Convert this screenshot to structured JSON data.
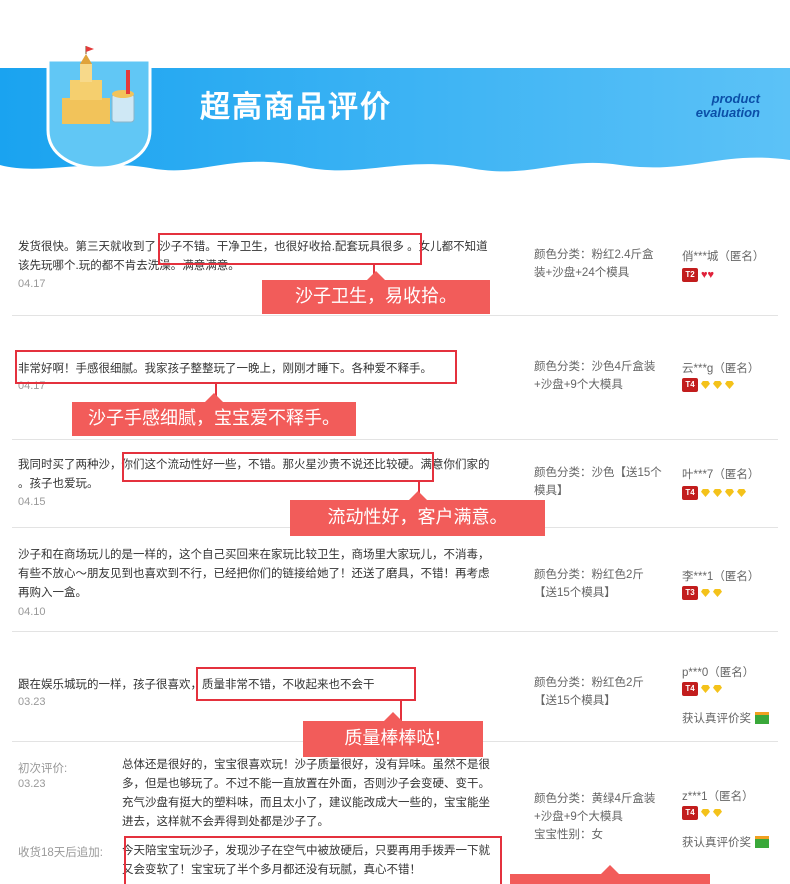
{
  "banner": {
    "title": "超高商品评价",
    "en_line1": "product",
    "en_line2": "evaluation"
  },
  "callouts": [
    "沙子卫生，易收拾。",
    "沙子手感细腻，宝宝爱不释手。",
    "流动性好，客户满意。",
    "质量棒棒哒!"
  ],
  "reviews": [
    {
      "lines": [
        "发货很快。第三天就收到了 沙子不错。干净卫生，也很好收拾.配套玩具很多 。女儿都不知道",
        "该先玩哪个.玩的都不肯去洗澡。满意满意。"
      ],
      "date": "04.17",
      "sku": [
        "颜色分类：粉红2.4斤盒",
        "装+沙盘+24个模具"
      ],
      "user": "俏***城（匿名）",
      "tier": "T2"
    },
    {
      "lines": [
        "非常好啊！手感很细腻。我家孩子整整玩了一晚上，刚刚才睡下。各种爱不释手。"
      ],
      "date": "04.17",
      "sku": [
        "颜色分类：沙色4斤盒装",
        "+沙盘+9个大模具"
      ],
      "user": "云***g（匿名）",
      "tier": "T4"
    },
    {
      "lines": [
        "我同时买了两种沙，你们这个流动性好一些，不错。那火星沙贵不说还比较硬。满意你们家的",
        "。孩子也爱玩。"
      ],
      "date": "04.15",
      "sku": [
        "颜色分类：沙色【送15个",
        "模具】"
      ],
      "user": "叶***7（匿名）",
      "tier": "T4"
    },
    {
      "lines": [
        "沙子和在商场玩儿的是一样的，这个自己买回来在家玩比较卫生，商场里大家玩儿，不消毒，",
        "有些不放心～朋友见到也喜欢到不行，已经把你们的链接给她了！还送了磨具，不错！再考虑",
        "再购入一盒。"
      ],
      "date": "04.10",
      "sku": [
        "颜色分类：粉红色2斤",
        "【送15个模具】"
      ],
      "user": "李***1（匿名）",
      "tier": "T3"
    },
    {
      "lines": [
        "跟在娱乐城玩的一样，孩子很喜欢，质量非常不错，不收起来也不会干"
      ],
      "date": "03.23",
      "sku": [
        "颜色分类：粉红色2斤",
        "【送15个模具】"
      ],
      "user": "p***0（匿名）",
      "tier": "T4",
      "real_review": "获认真评价奖"
    },
    {
      "first_label": "初次评价:",
      "date": "03.23",
      "lines": [
        "总体还是很好的，宝宝很喜欢玩！沙子质量很好，没有异味。虽然不是很",
        "多，但是也够玩了。不过不能一直放置在外面，否则沙子会变硬、变干。",
        "充气沙盘有挺大的塑料味，而且太小了，建议能改成大一些的，宝宝能坐",
        "进去，这样就不会弄得到处都是沙子了。"
      ],
      "follow_label": "收货18天后追加:",
      "follow_lines": [
        "今天陪宝宝玩沙子，发现沙子在空气中被放硬后，只要再用手拨弄一下就",
        "又会变软了！宝宝玩了半个多月都还没有玩腻，真心不错！"
      ],
      "sku": [
        "颜色分类：黄绿4斤盒装",
        "+沙盘+9个大模具",
        "宝宝性别：女"
      ],
      "user": "z***1（匿名）",
      "tier": "T4",
      "real_review": "获认真评价奖"
    }
  ]
}
